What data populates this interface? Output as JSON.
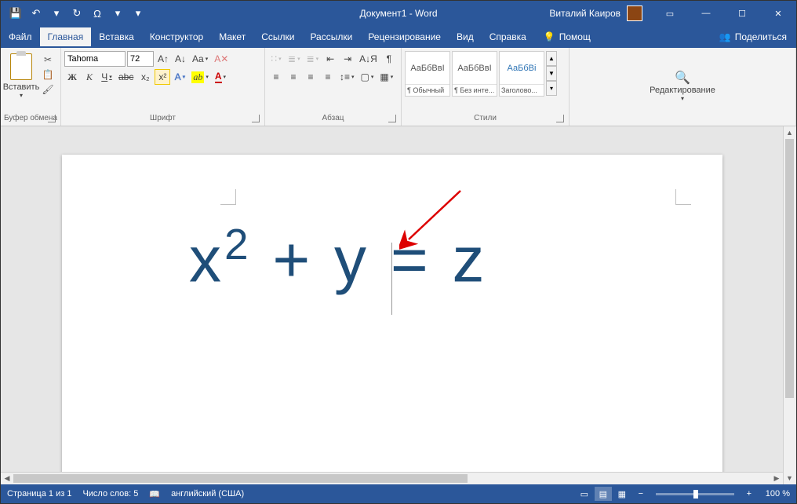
{
  "title": "Документ1 - Word",
  "user": "Виталий Каиров",
  "qat": {
    "save": "💾",
    "undo": "↶",
    "redo": "↻",
    "symbol": "Ω"
  },
  "tabs": {
    "file": "Файл",
    "items": [
      "Главная",
      "Вставка",
      "Конструктор",
      "Макет",
      "Ссылки",
      "Рассылки",
      "Рецензирование",
      "Вид",
      "Справка"
    ],
    "active": "Главная",
    "tellme": "Помощ",
    "share": "Поделиться"
  },
  "ribbon": {
    "clipboard": {
      "paste": "Вставить",
      "label": "Буфер обмена"
    },
    "font": {
      "name": "Tahoma",
      "size": "72",
      "label": "Шрифт",
      "bold": "Ж",
      "italic": "К",
      "underline": "Ч",
      "strike": "abc",
      "sub": "x₂",
      "sup": "x²",
      "grow": "A",
      "shrink": "A",
      "case": "Aa",
      "clear": "✕",
      "effects": "A",
      "highlight": "ab",
      "color": "A"
    },
    "paragraph": {
      "label": "Абзац",
      "sort": "А↓Я",
      "pilcrow": "¶"
    },
    "styles": {
      "label": "Стили",
      "items": [
        {
          "preview": "АаБбВвІ",
          "name": "¶ Обычный"
        },
        {
          "preview": "АаБбВвІ",
          "name": "¶ Без инте..."
        },
        {
          "preview": "АаБбВі",
          "name": "Заголово..."
        }
      ]
    },
    "editing": {
      "label": "Редактирование",
      "find": "🔍"
    }
  },
  "document": {
    "text_x": "x",
    "text_sup": "2",
    "text_rest": " + y = z"
  },
  "status": {
    "page": "Страница 1 из 1",
    "words": "Число слов: 5",
    "lang": "английский (США)",
    "zoom": "100 %",
    "minus": "−",
    "plus": "+"
  }
}
